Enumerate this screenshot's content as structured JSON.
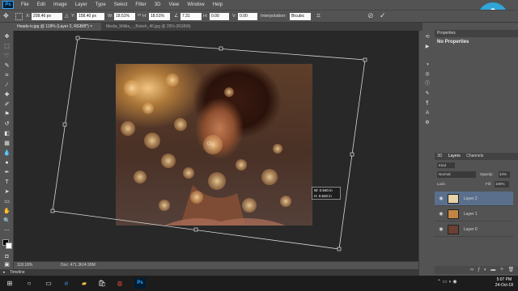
{
  "app": {
    "logo": "Ps"
  },
  "menu": [
    "File",
    "Edit",
    "Image",
    "Layer",
    "Type",
    "Select",
    "Filter",
    "3D",
    "View",
    "Window",
    "Help"
  ],
  "options": {
    "x_label": "X:",
    "x_value": "208.46 px",
    "y_label": "Y:",
    "y_value": "158.40 px",
    "w_label": "W:",
    "w_value": "18.51%",
    "h_label": "H:",
    "h_value": "18.51%",
    "angle_value": "7.31",
    "h_skew_label": "H:",
    "h_skew_value": "0.00",
    "v_skew_label": "V:",
    "v_skew_value": "0.00",
    "interp_label": "Interpolation:",
    "interp_value": "Bicubic"
  },
  "tabs": [
    {
      "label": "Heads-iv.jpg @ 118% (Layer 2, RGB/8*) ×"
    },
    {
      "label": "Media_Militia_-_Bokeh_46.jpg @ 25% (RGB/8)"
    }
  ],
  "tooltip": {
    "w_line": "W: 0.940 in",
    "h_line": "H: 0.540 in"
  },
  "status": {
    "zoom": "118.18%",
    "doc": "Doc: 471.3K/4.99M"
  },
  "timeline": {
    "label": "Timeline"
  },
  "properties": {
    "tab": "Properties",
    "no_props": "No Properties"
  },
  "layers_panel": {
    "tabs": [
      "3D",
      "Layers",
      "Channels"
    ],
    "kind": "Kind",
    "blend_mode": "Normal",
    "opacity_label": "Opacity:",
    "opacity_value": "34%",
    "lock_label": "Lock:",
    "fill_label": "Fill:",
    "fill_value": "100%",
    "layers": [
      {
        "name": "Layer 2",
        "selected": true
      },
      {
        "name": "Layer 1",
        "selected": false
      },
      {
        "name": "Layer 0",
        "selected": false
      }
    ]
  },
  "taskbar": {
    "time": "5:07 PM",
    "date": "24-Oct-18"
  },
  "colors": {
    "accent": "#31a8ff",
    "selected_layer": "#5a6f8c",
    "canvas_bg": "#282828",
    "watermark": "#2fa5d8"
  }
}
